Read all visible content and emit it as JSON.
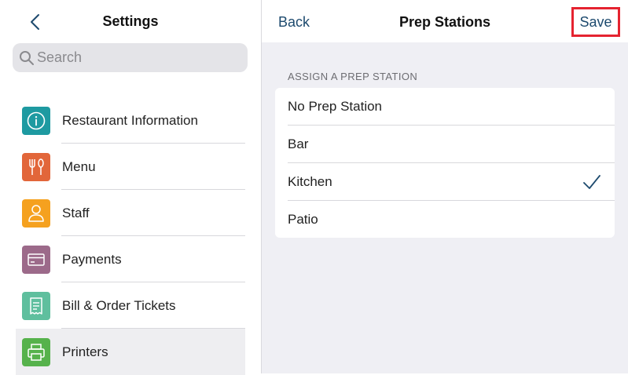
{
  "sidebar": {
    "title": "Settings",
    "search": {
      "placeholder": "Search"
    },
    "items": [
      {
        "label": "Restaurant Information",
        "icon": "info-icon",
        "color": "#1e9aa1"
      },
      {
        "label": "Menu",
        "icon": "fork-knife-icon",
        "color": "#e2663a"
      },
      {
        "label": "Staff",
        "icon": "person-icon",
        "color": "#f5a11f"
      },
      {
        "label": "Payments",
        "icon": "credit-card-icon",
        "color": "#9c6a8a"
      },
      {
        "label": "Bill & Order Tickets",
        "icon": "receipt-icon",
        "color": "#5fbf9e"
      },
      {
        "label": "Printers",
        "icon": "printer-icon",
        "color": "#56b24c",
        "selected": true
      }
    ]
  },
  "main": {
    "back_label": "Back",
    "title": "Prep Stations",
    "save_label": "Save",
    "section_label": "ASSIGN A PREP STATION",
    "options": [
      {
        "label": "No Prep Station",
        "checked": false
      },
      {
        "label": "Bar",
        "checked": false
      },
      {
        "label": "Kitchen",
        "checked": true
      },
      {
        "label": "Patio",
        "checked": false
      }
    ]
  },
  "colors": {
    "accent": "#1d4a6e",
    "highlight_border": "#e52330",
    "panel_background": "#efeff4"
  }
}
